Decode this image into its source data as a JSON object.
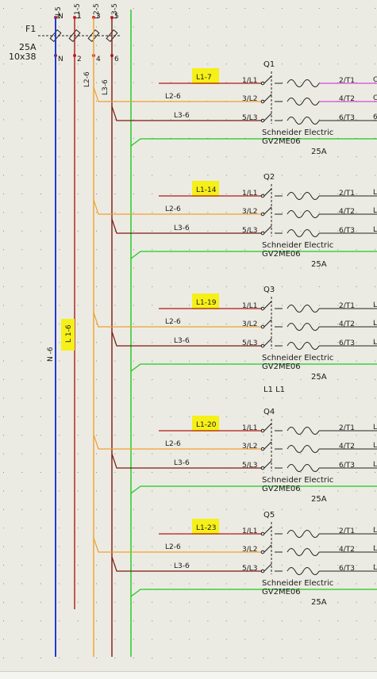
{
  "fuse": {
    "designation": "F1",
    "rating": "25A",
    "size": "10x38",
    "top_terminals": [
      "N-5",
      "L1-5",
      "L2-5",
      "L3-5"
    ],
    "top_nums": [
      "N",
      "1",
      "3",
      "5"
    ],
    "bottom_nums": [
      "N",
      "2",
      "4",
      "6"
    ]
  },
  "busbars": {
    "vertical_labels": [
      "L2-6",
      "L3-6"
    ],
    "neutral_label": "N -6",
    "l1_tag": "L 1-6"
  },
  "colors": {
    "neutral": "#1f3ad0",
    "l1": "#b01818",
    "l2": "#f0a030",
    "l3": "#7a1a10",
    "pe": "#1fc81f",
    "magenta": "#d020d0",
    "tag_bg": "#f5f018",
    "grid_dot": "#8a8a80"
  },
  "text": {
    "between_label": "L1 L1"
  },
  "breakers": [
    {
      "ref": "Q1",
      "l1_tag": "L1-7",
      "l2_label": "L2-6",
      "l3_label": "L3-6",
      "in_terms": [
        "1/L1",
        "3/L2",
        "5/L3"
      ],
      "out_terms": [
        "2/T1",
        "4/T2",
        "6/T3"
      ],
      "out_tails": [
        "C",
        "C",
        "6"
      ],
      "maker": "Schneider Electric",
      "model": "GV2ME06",
      "rating": "25A"
    },
    {
      "ref": "Q2",
      "l1_tag": "L1-14",
      "l2_label": "L2-6",
      "l3_label": "L3-6",
      "in_terms": [
        "1/L1",
        "3/L2",
        "5/L3"
      ],
      "out_terms": [
        "2/T1",
        "4/T2",
        "6/T3"
      ],
      "out_tails": [
        "L",
        "L",
        "L"
      ],
      "maker": "Schneider Electric",
      "model": "GV2ME06",
      "rating": "25A"
    },
    {
      "ref": "Q3",
      "l1_tag": "L1-19",
      "l2_label": "L2-6",
      "l3_label": "L3-6",
      "in_terms": [
        "1/L1",
        "3/L2",
        "5/L3"
      ],
      "out_terms": [
        "2/T1",
        "4/T2",
        "6/T3"
      ],
      "out_tails": [
        "L",
        "L",
        "L"
      ],
      "maker": "Schneider Electric",
      "model": "GV2ME06",
      "rating": "25A"
    },
    {
      "ref": "Q4",
      "l1_tag": "L1-20",
      "l2_label": "L2-6",
      "l3_label": "L3-6",
      "in_terms": [
        "1/L1",
        "3/L2",
        "5/L3"
      ],
      "out_terms": [
        "2/T1",
        "4/T2",
        "6/T3"
      ],
      "out_tails": [
        "L",
        "L",
        "L"
      ],
      "maker": "Schneider Electric",
      "model": "GV2ME06",
      "rating": "25A"
    },
    {
      "ref": "Q5",
      "l1_tag": "L1-23",
      "l2_label": "L2-6",
      "l3_label": "L3-6",
      "in_terms": [
        "1/L1",
        "3/L2",
        "5/L3"
      ],
      "out_terms": [
        "2/T1",
        "4/T2",
        "6/T3"
      ],
      "out_tails": [
        "L",
        "L",
        "L"
      ],
      "maker": "Schneider Electric",
      "model": "GV2ME06",
      "rating": "25A"
    }
  ]
}
